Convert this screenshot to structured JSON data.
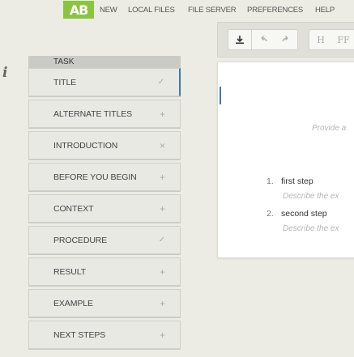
{
  "nav": {
    "logo": "AB",
    "links": [
      "NEW",
      "LOCAL FILES",
      "FILE SERVER",
      "PREFERENCES",
      "HELP"
    ]
  },
  "info_icon": "info-icon",
  "toolbar": {
    "buttons": [
      "download-icon",
      "undo-icon",
      "redo-icon",
      "H",
      "FF"
    ]
  },
  "editor": {
    "prompt": "Provide a",
    "steps": [
      {
        "num": "1.",
        "title": "first step",
        "desc": "Describe the ex"
      },
      {
        "num": "2.",
        "title": "second step",
        "desc": "Describe the ex"
      }
    ]
  },
  "task": {
    "header": "TASK",
    "items": [
      {
        "label": "TITLE",
        "icon": "check"
      },
      {
        "label": "ALTERNATE TITLES",
        "icon": "plus"
      },
      {
        "label": "INTRODUCTION",
        "icon": "close"
      },
      {
        "label": "BEFORE YOU BEGIN",
        "icon": "plus"
      },
      {
        "label": "CONTEXT",
        "icon": "plus"
      },
      {
        "label": "PROCEDURE",
        "icon": "check"
      },
      {
        "label": "RESULT",
        "icon": "plus"
      },
      {
        "label": "EXAMPLE",
        "icon": "plus"
      },
      {
        "label": "NEXT STEPS",
        "icon": "plus"
      }
    ]
  }
}
